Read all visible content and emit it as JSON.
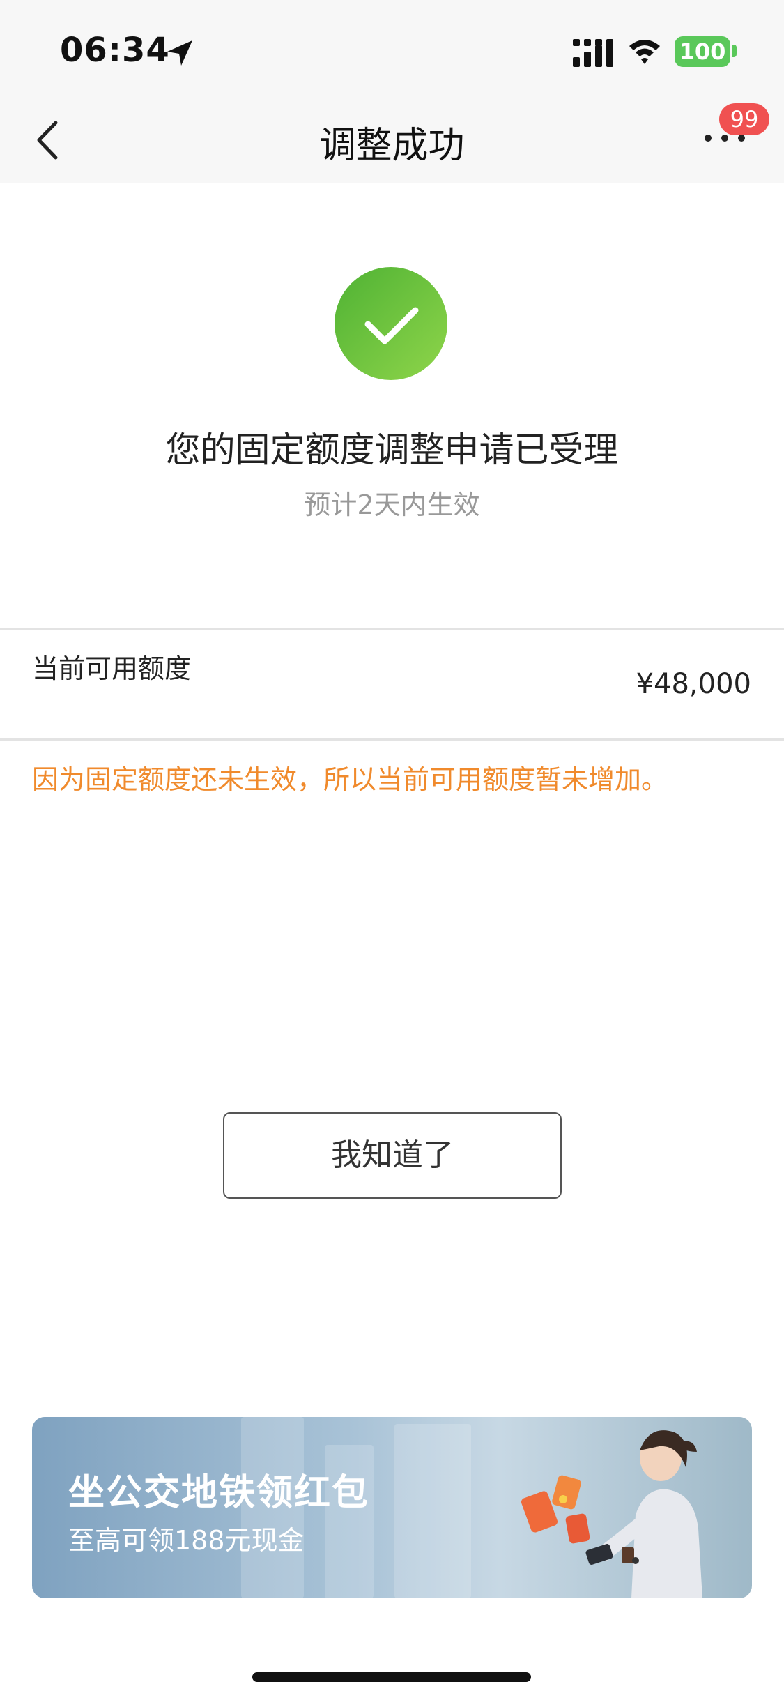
{
  "status_bar": {
    "time": "06:34",
    "battery": "100"
  },
  "nav": {
    "title": "调整成功",
    "badge": "99"
  },
  "result": {
    "title": "您的固定额度调整申请已受理",
    "subtitle": "预计2天内生效"
  },
  "credit": {
    "label": "当前可用额度",
    "value": "¥48,000"
  },
  "notice": "因为固定额度还未生效，所以当前可用额度暂未增加。",
  "actions": {
    "ok_label": "我知道了"
  },
  "promo": {
    "title": "坐公交地铁领红包",
    "subtitle": "至高可领188元现金"
  },
  "colors": {
    "accent_orange": "#f08a2c",
    "success_green": "#5bbf3d",
    "badge_red": "#f05151"
  }
}
